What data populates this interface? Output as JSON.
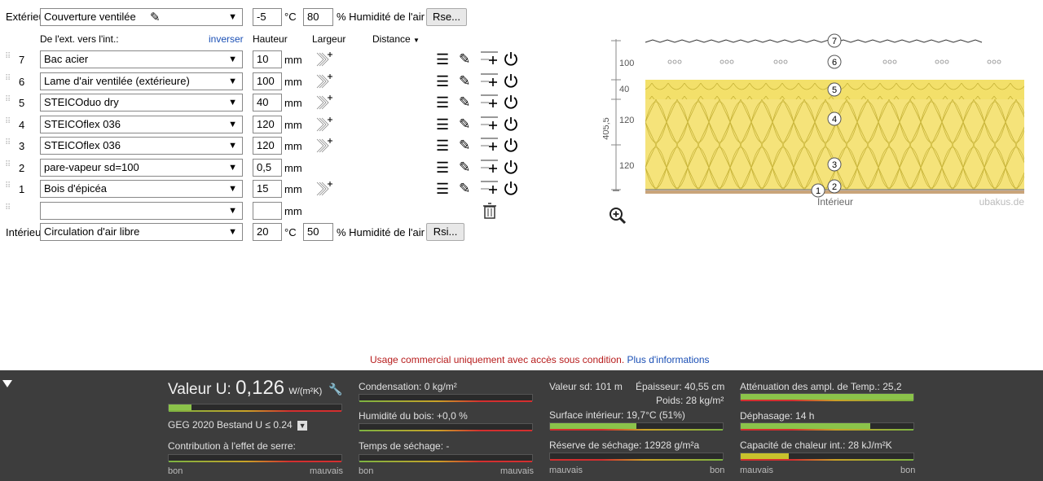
{
  "exterior": {
    "label": "Extérieur",
    "material": "Couverture ventilée",
    "temp": "-5",
    "temp_unit": "°C",
    "humidity": "80",
    "humidity_label": "% Humidité de l'air",
    "button": "Rse..."
  },
  "headers": {
    "direction": "De l'ext. vers l'int.:",
    "invert": "inverser",
    "height": "Hauteur",
    "width": "Largeur",
    "distance": "Distance"
  },
  "layers": [
    {
      "num": "7",
      "material": "Bac acier",
      "value": "10",
      "unit": "mm"
    },
    {
      "num": "6",
      "material": "Lame d'air ventilée (extérieure)",
      "value": "100",
      "unit": "mm"
    },
    {
      "num": "5",
      "material": "STEICOduo dry",
      "value": "40",
      "unit": "mm"
    },
    {
      "num": "4",
      "material": "STEICOflex 036",
      "value": "120",
      "unit": "mm"
    },
    {
      "num": "3",
      "material": "STEICOflex 036",
      "value": "120",
      "unit": "mm"
    },
    {
      "num": "2",
      "material": "pare-vapeur sd=100",
      "value": "0,5",
      "unit": "mm"
    },
    {
      "num": "1",
      "material": "Bois d'épicéa",
      "value": "15",
      "unit": "mm"
    },
    {
      "num": "",
      "material": "",
      "value": "",
      "unit": "mm"
    }
  ],
  "interior": {
    "label": "Intérieur",
    "material": "Circulation d'air libre",
    "temp": "20",
    "temp_unit": "°C",
    "humidity": "50",
    "humidity_label": "% Humidité de l'air",
    "button": "Rsi..."
  },
  "diagram": {
    "dim_total": "405,5",
    "dims": [
      "100",
      "40",
      "120",
      "120"
    ],
    "labels": [
      "7",
      "6",
      "5",
      "4",
      "3",
      "2",
      "1"
    ],
    "interior_label": "Intérieur",
    "watermark": "ubakus.de",
    "zoom_icon": "zoom-in-icon"
  },
  "notice": {
    "text": "Usage commercial uniquement avec accès sous condition.",
    "link": "Plus d'informations"
  },
  "results": {
    "u_label": "Valeur U:",
    "u_value": "0,126",
    "u_unit": "W/(m²K)",
    "standard": "GEG 2020 Bestand U ≤ 0.24",
    "greenhouse": "Contribution à l'effet de serre:",
    "condensation": "Condensation: 0 kg/m²",
    "wood_humidity": "Humidité du bois: +0,0 %",
    "drying_time": "Temps de séchage: -",
    "sd_value": "Valeur sd: 101 m",
    "thickness": "Épaisseur: 40,55 cm",
    "weight": "Poids: 28 kg/m²",
    "surface_interior": "Surface intérieur: 19,7°C (51%)",
    "drying_reserve": "Réserve de séchage: 12928 g/m²a",
    "attenuation": "Atténuation des ampl. de Temp.: 25,2",
    "phase_shift": "Déphasage: 14 h",
    "heat_capacity": "Capacité de chaleur int.: 28 kJ/m²K",
    "good": "bon",
    "bad": "mauvais",
    "levels": {
      "u_value": 0.13,
      "surface_interior": 0.5,
      "attenuation": 1.0,
      "phase_shift": 0.75,
      "heat_capacity": 0.28
    }
  }
}
